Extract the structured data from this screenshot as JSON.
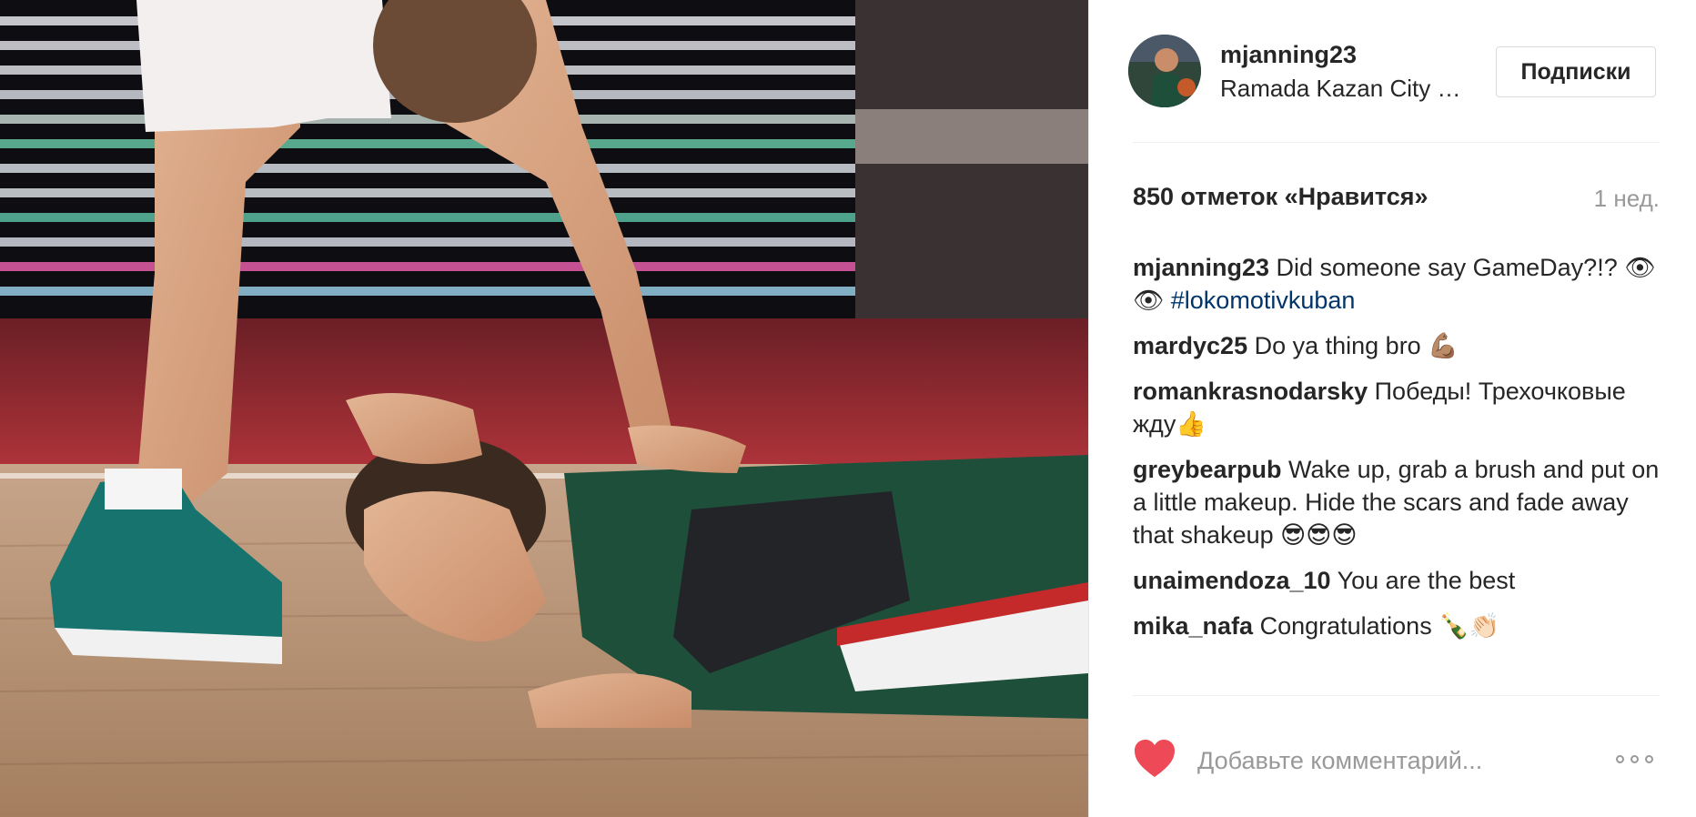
{
  "post": {
    "photo_alt": "Basketball player lying on court floor",
    "username": "mjanning23",
    "location": "Ramada Kazan City Center",
    "follow_label": "Подписки",
    "likes": "850 отметок «Нравится»",
    "time_ago": "1 нед."
  },
  "comments": [
    {
      "user": "mjanning23",
      "text": " Did someone say GameDay?!? 👁👁 ",
      "tag": "#lokomotivkuban"
    },
    {
      "user": "mardyc25",
      "text": " Do ya thing bro 💪🏽",
      "tag": ""
    },
    {
      "user": "romankrasnodarsky",
      "text": " Победы! Трехочковые жду👍",
      "tag": ""
    },
    {
      "user": "greybearpub",
      "text": " Wake up, grab a brush and put on a little makeup. Hide the scars and fade away that shakeup 😎😎😎",
      "tag": ""
    },
    {
      "user": "unaimendoza_10",
      "text": " You are the best",
      "tag": ""
    },
    {
      "user": "mika_nafa",
      "text": " Congratulations 🍾👏🏻",
      "tag": ""
    }
  ],
  "footer": {
    "comment_placeholder": "Добавьте комментарий...",
    "heart_icon": "heart-icon",
    "more_icon": "more-options-icon",
    "heart_color": "#ed4956"
  }
}
